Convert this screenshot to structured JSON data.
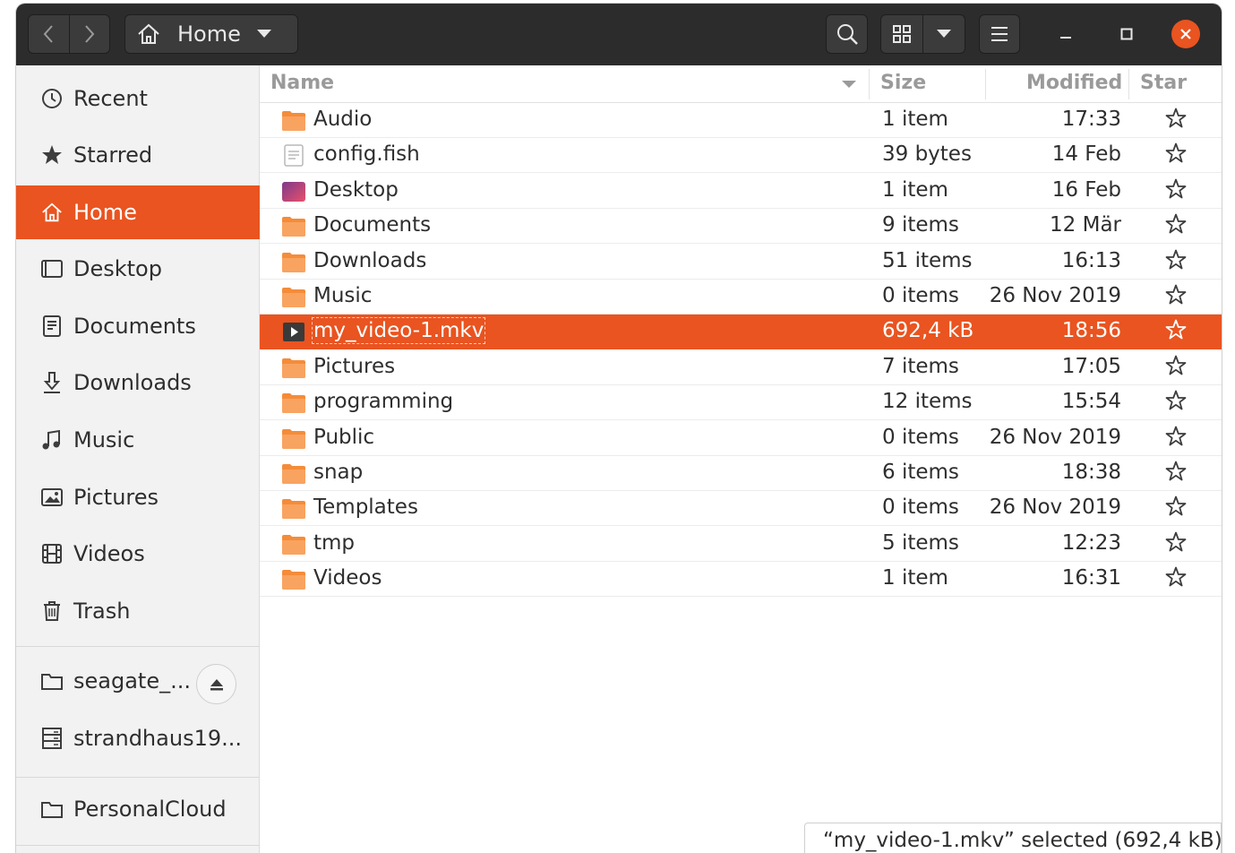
{
  "window": {
    "path_label": "Home",
    "accent_color": "#e95420",
    "headerbar_color": "#2c2c2c"
  },
  "sidebar": {
    "items": [
      {
        "label": "Recent",
        "icon": "clock-icon"
      },
      {
        "label": "Starred",
        "icon": "star-icon"
      },
      {
        "label": "Home",
        "icon": "home-icon",
        "active": true
      },
      {
        "label": "Desktop",
        "icon": "desktop-icon"
      },
      {
        "label": "Documents",
        "icon": "document-icon"
      },
      {
        "label": "Downloads",
        "icon": "download-icon"
      },
      {
        "label": "Music",
        "icon": "music-icon"
      },
      {
        "label": "Pictures",
        "icon": "picture-icon"
      },
      {
        "label": "Videos",
        "icon": "film-icon"
      },
      {
        "label": "Trash",
        "icon": "trash-icon"
      }
    ],
    "devices": [
      {
        "label": "seagate_...",
        "icon": "drive-icon"
      },
      {
        "label": "strandhaus19...",
        "icon": "server-icon"
      }
    ],
    "bookmarks": [
      {
        "label": "PersonalCloud",
        "icon": "drive-icon"
      }
    ]
  },
  "columns": {
    "name": "Name",
    "size": "Size",
    "modified": "Modified",
    "star": "Star"
  },
  "files": [
    {
      "name": "Audio",
      "size": "1 item",
      "modified": "17:33",
      "type": "folder"
    },
    {
      "name": "config.fish",
      "size": "39 bytes",
      "modified": "14 Feb",
      "type": "text"
    },
    {
      "name": "Desktop",
      "size": "1 item",
      "modified": "16 Feb",
      "type": "desktop-folder"
    },
    {
      "name": "Documents",
      "size": "9 items",
      "modified": "12 Mär",
      "type": "folder"
    },
    {
      "name": "Downloads",
      "size": "51 items",
      "modified": "16:13",
      "type": "folder"
    },
    {
      "name": "Music",
      "size": "0 items",
      "modified": "26 Nov 2019",
      "type": "folder"
    },
    {
      "name": "my_video-1.mkv",
      "size": "692,4 kB",
      "modified": "18:56",
      "type": "video",
      "selected": true
    },
    {
      "name": "Pictures",
      "size": "7 items",
      "modified": "17:05",
      "type": "folder"
    },
    {
      "name": "programming",
      "size": "12 items",
      "modified": "15:54",
      "type": "folder"
    },
    {
      "name": "Public",
      "size": "0 items",
      "modified": "26 Nov 2019",
      "type": "folder"
    },
    {
      "name": "snap",
      "size": "6 items",
      "modified": "18:38",
      "type": "folder"
    },
    {
      "name": "Templates",
      "size": "0 items",
      "modified": "26 Nov 2019",
      "type": "folder"
    },
    {
      "name": "tmp",
      "size": "5 items",
      "modified": "12:23",
      "type": "folder"
    },
    {
      "name": "Videos",
      "size": "1 item",
      "modified": "16:31",
      "type": "folder"
    }
  ],
  "status": {
    "text": "“my_video-1.mkv” selected  (692,4 kB)"
  }
}
